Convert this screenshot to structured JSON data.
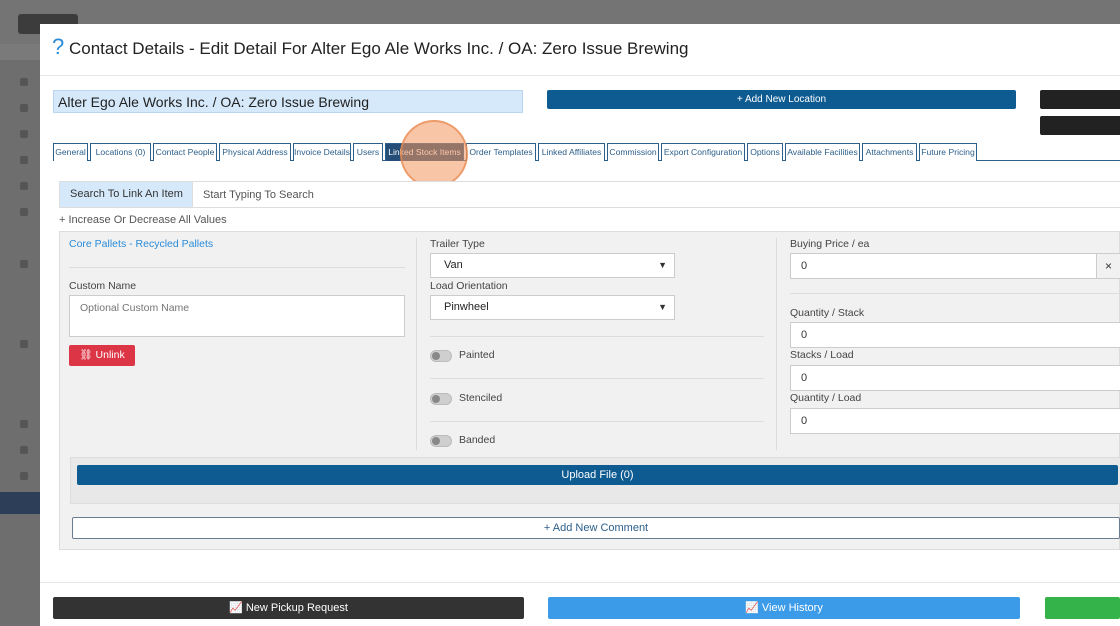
{
  "modal": {
    "help_icon": "?",
    "title": "Contact Details - Edit Detail For Alter Ego Ale Works Inc. / OA: Zero Issue Brewing"
  },
  "header": {
    "name_value": "Alter Ego Ale Works Inc. / OA: Zero Issue Brewing",
    "add_location": "+ Add New Location"
  },
  "tabs": [
    {
      "label": "General"
    },
    {
      "label": "Locations (0)"
    },
    {
      "label": "Contact People"
    },
    {
      "label": "Physical Address"
    },
    {
      "label": "Invoice Details"
    },
    {
      "label": "Users"
    },
    {
      "label": "Linked Stock Items",
      "active": true
    },
    {
      "label": "Order Templates"
    },
    {
      "label": "Linked Affiliates"
    },
    {
      "label": "Commission"
    },
    {
      "label": "Export Configuration"
    },
    {
      "label": "Options"
    },
    {
      "label": "Available Facilities"
    },
    {
      "label": "Attachments"
    },
    {
      "label": "Future Pricing"
    }
  ],
  "search": {
    "label": "Search To Link An Item",
    "placeholder": "Start Typing To Search"
  },
  "increase_all": "+ Increase Or Decrease All Values",
  "item": {
    "link": "Core Pallets - Recycled Pallets",
    "custom_name_label": "Custom Name",
    "custom_name_placeholder": "Optional Custom Name",
    "unlink": "⛓ Unlink",
    "trailer_type_label": "Trailer Type",
    "trailer_type_value": "Van",
    "load_orientation_label": "Load Orientation",
    "load_orientation_value": "Pinwheel",
    "toggles": [
      {
        "label": "Painted",
        "on": false
      },
      {
        "label": "Stenciled",
        "on": false
      },
      {
        "label": "Banded",
        "on": false
      }
    ],
    "buying_price_label": "Buying Price / ea",
    "buying_price_value": "0",
    "clear": "×",
    "quantity_stack_label": "Quantity / Stack",
    "quantity_stack_value": "0",
    "stacks_load_label": "Stacks / Load",
    "stacks_load_value": "0",
    "quantity_load_label": "Quantity / Load",
    "quantity_load_value": "0",
    "upload": "Upload File (0)",
    "add_comment": "+ Add New Comment"
  },
  "footer": {
    "new_pickup": "📈 New Pickup Request",
    "view_history": "📈 View History"
  },
  "colors": {
    "primary": "#0e5b92",
    "active_tab": "#244e77",
    "danger": "#dc3545",
    "info": "#3c9be8",
    "success": "#34b34a",
    "highlight": "#f4965f"
  }
}
